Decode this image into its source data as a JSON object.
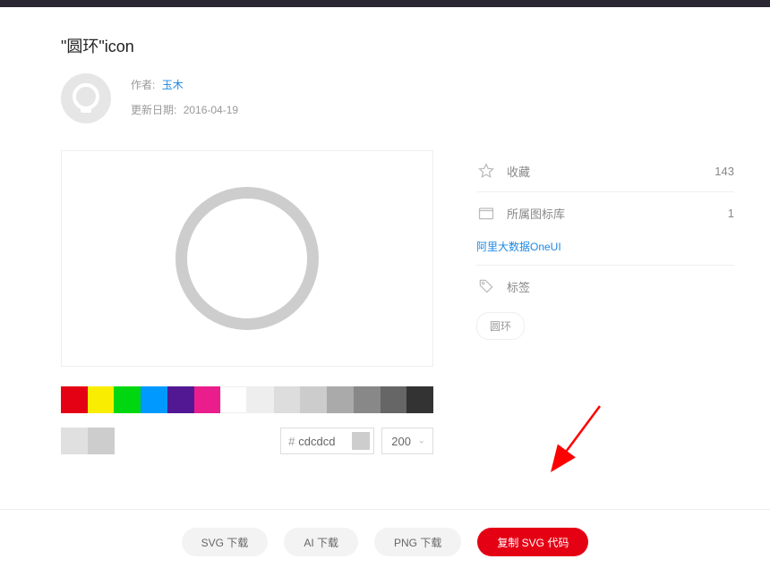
{
  "title": "\"圆环\"icon",
  "author": {
    "label": "作者:",
    "name": "玉木"
  },
  "date": {
    "label": "更新日期:",
    "value": "2016-04-19"
  },
  "palette": [
    "#e50114",
    "#f9ee02",
    "#00d711",
    "#0099ff",
    "#521894",
    "#e91e8c",
    "#ffffff",
    "#eeeeee",
    "#dddddd",
    "#cccccc",
    "#aaaaaa",
    "#888888",
    "#666666",
    "#333333"
  ],
  "shades": [
    "#e0e0e0",
    "#cdcdcd"
  ],
  "hex": "cdcdcd",
  "size": "200",
  "stats": {
    "favorites_label": "收藏",
    "favorites_count": "143",
    "library_label": "所属图标库",
    "library_count": "1",
    "library_name": "阿里大数据OneUI",
    "tags_label": "标签"
  },
  "tags": [
    "圆环"
  ],
  "buttons": {
    "svg": "SVG 下载",
    "ai": "AI 下载",
    "png": "PNG 下载",
    "copy": "复制 SVG 代码"
  }
}
